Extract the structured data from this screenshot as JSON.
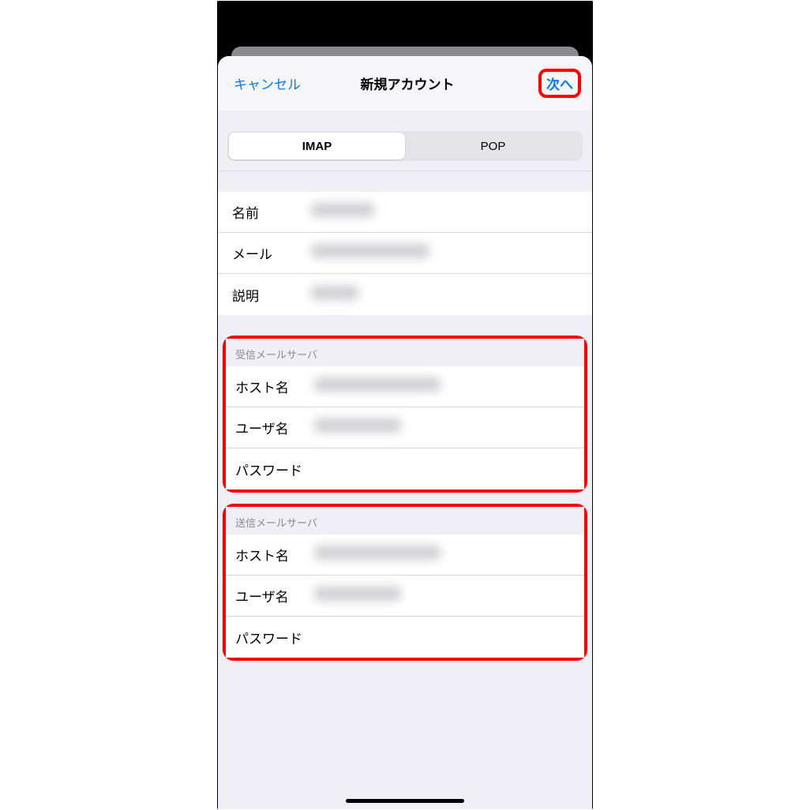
{
  "nav": {
    "cancel": "キャンセル",
    "title": "新規アカウント",
    "next": "次へ"
  },
  "segment": {
    "imap": "IMAP",
    "pop": "POP"
  },
  "account": {
    "name_label": "名前",
    "email_label": "メール",
    "desc_label": "説明"
  },
  "incoming": {
    "header": "受信メールサーバ",
    "host_label": "ホスト名",
    "user_label": "ユーザ名",
    "pass_label": "パスワード"
  },
  "outgoing": {
    "header": "送信メールサーバ",
    "host_label": "ホスト名",
    "user_label": "ユーザ名",
    "pass_label": "パスワード"
  },
  "colors": {
    "highlight": "#ff0000",
    "link": "#007aff"
  }
}
